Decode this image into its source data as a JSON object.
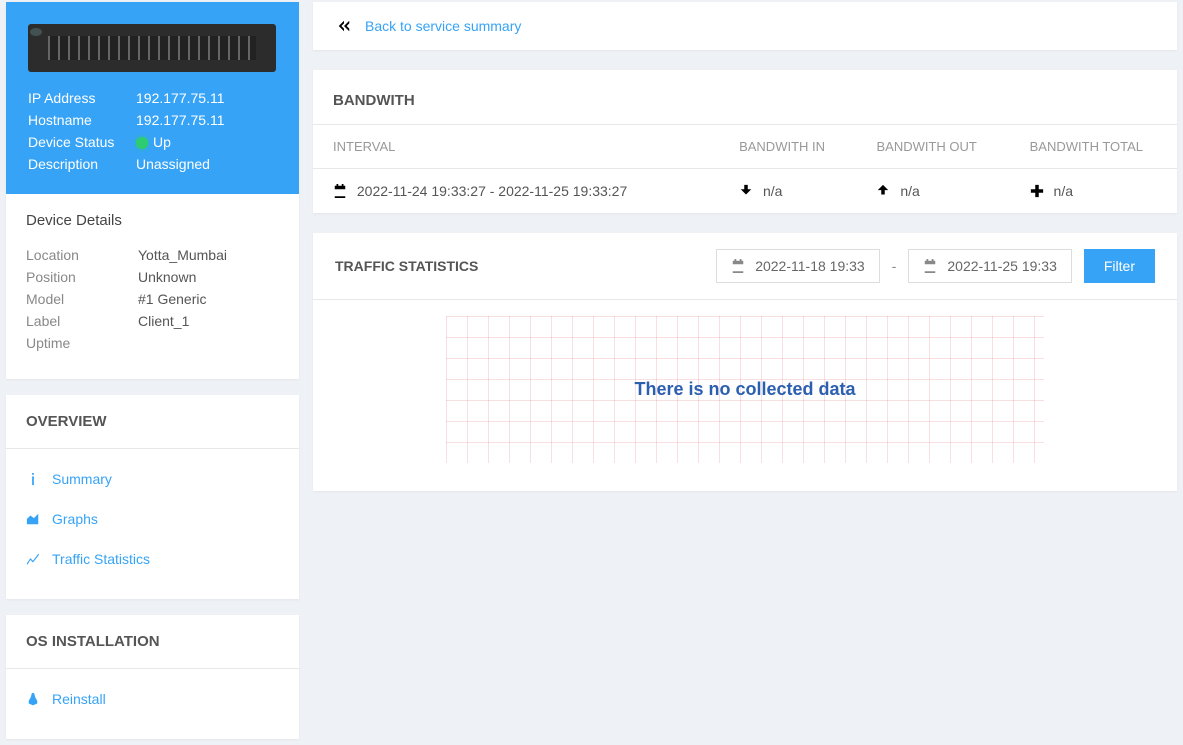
{
  "back_link": "Back to service summary",
  "device_info": {
    "ip_label": "IP Address",
    "ip_value": "192.177.75.11",
    "host_label": "Hostname",
    "host_value": "192.177.75.11",
    "status_label": "Device Status",
    "status_value": "Up",
    "desc_label": "Description",
    "desc_value": "Unassigned"
  },
  "device_details": {
    "title": "Device Details",
    "location_label": "Location",
    "location_value": "Yotta_Mumbai",
    "position_label": "Position",
    "position_value": "Unknown",
    "model_label": "Model",
    "model_value": "#1 Generic",
    "labelkey_label": "Label",
    "labelkey_value": "Client_1",
    "uptime_label": "Uptime",
    "uptime_value": ""
  },
  "overview": {
    "title": "OVERVIEW",
    "summary": "Summary",
    "graphs": "Graphs",
    "traffic": "Traffic Statistics"
  },
  "os_installation": {
    "title": "OS INSTALLATION",
    "reinstall": "Reinstall"
  },
  "bandwidth": {
    "title": "BANDWITH",
    "col_interval": "INTERVAL",
    "col_in": "BANDWITH IN",
    "col_out": "BANDWITH OUT",
    "col_total": "BANDWITH TOTAL",
    "row_interval": "2022-11-24 19:33:27 - 2022-11-25 19:33:27",
    "row_in": "n/a",
    "row_out": "n/a",
    "row_total": "n/a"
  },
  "traffic": {
    "title": "TRAFFIC STATISTICS",
    "date_from": "2022-11-18 19:33",
    "date_sep": "-",
    "date_to": "2022-11-25 19:33",
    "filter": "Filter",
    "no_data": "There is no collected data"
  },
  "chart_data": {
    "type": "line",
    "series": [],
    "xlabel": "",
    "ylabel": "",
    "message": "There is no collected data"
  }
}
